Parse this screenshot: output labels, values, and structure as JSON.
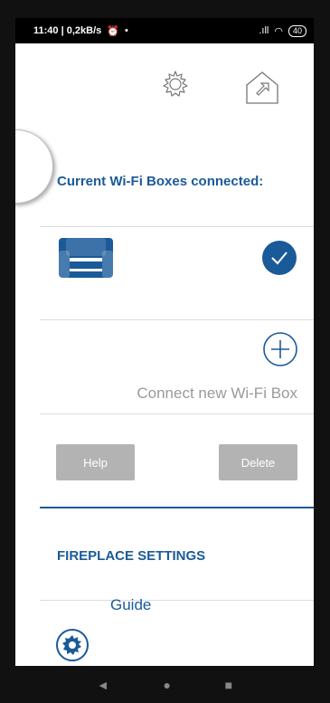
{
  "status_bar": {
    "time_net": "11:40 | 0,2kB/s",
    "battery": "40"
  },
  "header": {
    "settings_icon": "gear-icon",
    "home_icon": "home-arrow-icon"
  },
  "connected": {
    "title": "Current Wi-Fi Boxes connected:",
    "device_icon": "armchair-icon",
    "selected": true
  },
  "add": {
    "label": "Connect new Wi-Fi Box"
  },
  "buttons": {
    "help": "Help",
    "delete": "Delete"
  },
  "fireplace": {
    "title": "FIREPLACE SETTINGS",
    "guide": "Guide"
  },
  "colors": {
    "accent": "#1b5a99",
    "muted": "#9a9a9a",
    "button_gray": "#b3b3b3"
  },
  "nav": {
    "back": "◄",
    "home": "●",
    "recents": "■"
  }
}
